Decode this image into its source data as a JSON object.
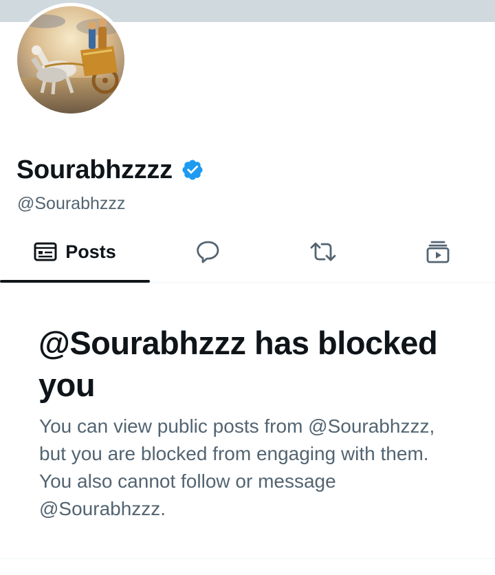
{
  "profile": {
    "display_name": "Sourabhzzzz",
    "handle": "@Sourabhzzz",
    "verified": true
  },
  "tabs": [
    {
      "label": "Posts",
      "icon": "posts-icon",
      "active": true
    },
    {
      "label": "",
      "icon": "replies-icon",
      "active": false
    },
    {
      "label": "",
      "icon": "reposts-icon",
      "active": false
    },
    {
      "label": "",
      "icon": "media-icon",
      "active": false
    }
  ],
  "blocked": {
    "title": "@Sourabhzzz has blocked you",
    "description": "You can view public posts from @Sourabhzzz, but you are blocked from engaging with them. You also cannot follow or message @Sourabhzzz."
  },
  "colors": {
    "text_primary": "#0f1419",
    "text_secondary": "#536471",
    "verified_blue": "#1d9bf0",
    "banner": "#cfd9de",
    "divider": "#eff3f4"
  }
}
